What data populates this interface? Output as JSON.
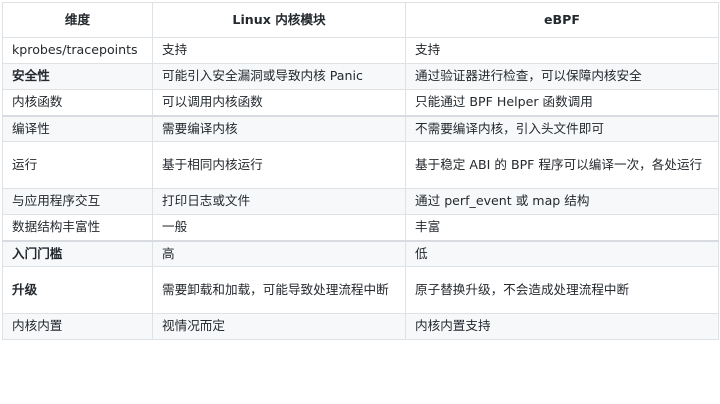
{
  "table": {
    "headers": [
      "维度",
      "Linux 内核模块",
      "eBPF"
    ],
    "rows": [
      {
        "dim": "kprobes/tracepoints",
        "kmod": "支持",
        "ebpf": "支持"
      },
      {
        "dim": "安全性",
        "kmod": "可能引入安全漏洞或导致内核 Panic",
        "ebpf": "通过验证器进行检查，可以保障内核安全"
      },
      {
        "dim": "内核函数",
        "kmod": "可以调用内核函数",
        "ebpf": "只能通过 BPF Helper 函数调用"
      },
      {
        "dim": "编译性",
        "kmod": "需要编译内核",
        "ebpf": "不需要编译内核，引入头文件即可"
      },
      {
        "dim": "运行",
        "kmod": "基于相同内核运行",
        "ebpf": "基于稳定 ABI 的 BPF 程序可以编译一次，各处运行"
      },
      {
        "dim": "与应用程序交互",
        "kmod": "打印日志或文件",
        "ebpf": "通过 perf_event 或 map 结构"
      },
      {
        "dim": "数据结构丰富性",
        "kmod": "一般",
        "ebpf": "丰富"
      },
      {
        "dim": "入门门槛",
        "kmod": "高",
        "ebpf": "低"
      },
      {
        "dim": "升级",
        "kmod": "需要卸载和加载，可能导致处理流程中断",
        "ebpf": "原子替换升级，不会造成处理流程中断"
      },
      {
        "dim": "内核内置",
        "kmod": "视情况而定",
        "ebpf": "内核内置支持"
      }
    ]
  }
}
